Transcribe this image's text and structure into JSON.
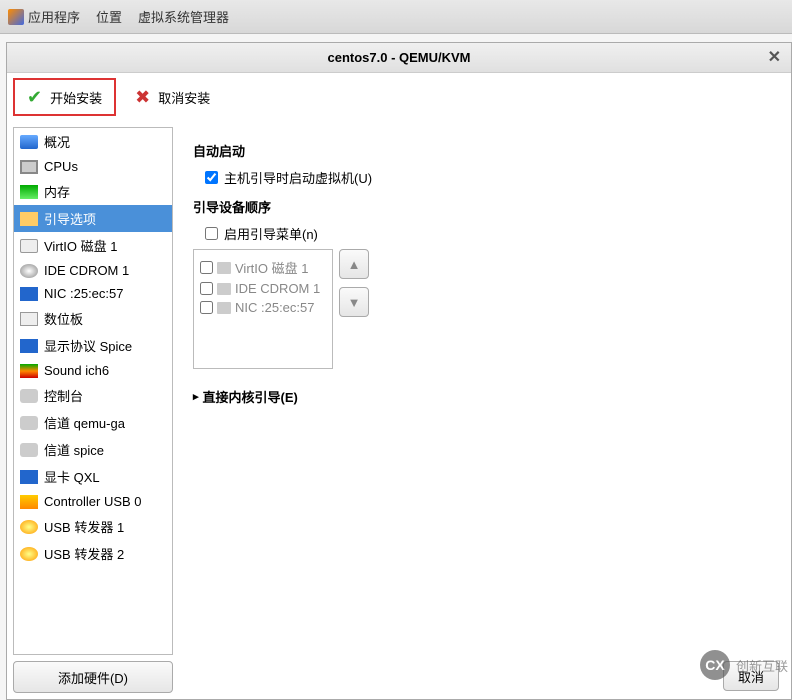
{
  "top_bar": {
    "apps": "应用程序",
    "places": "位置",
    "vmm": "虚拟系统管理器"
  },
  "window": {
    "title": "centos7.0 - QEMU/KVM"
  },
  "toolbar": {
    "begin_install": "开始安装",
    "cancel_install": "取消安装"
  },
  "sidebar": {
    "items": [
      {
        "label": "概况",
        "icon": "ic-monitor"
      },
      {
        "label": "CPUs",
        "icon": "ic-cpu"
      },
      {
        "label": "内存",
        "icon": "ic-mem"
      },
      {
        "label": "引导选项",
        "icon": "ic-boot",
        "selected": true
      },
      {
        "label": "VirtIO 磁盘 1",
        "icon": "ic-disk"
      },
      {
        "label": "IDE CDROM 1",
        "icon": "ic-cd"
      },
      {
        "label": "NIC :25:ec:57",
        "icon": "ic-nic"
      },
      {
        "label": "数位板",
        "icon": "ic-tablet"
      },
      {
        "label": "显示协议 Spice",
        "icon": "ic-display"
      },
      {
        "label": "Sound ich6",
        "icon": "ic-sound"
      },
      {
        "label": "控制台",
        "icon": "ic-serial"
      },
      {
        "label": "信道 qemu-ga",
        "icon": "ic-serial"
      },
      {
        "label": "信道 spice",
        "icon": "ic-serial"
      },
      {
        "label": "显卡 QXL",
        "icon": "ic-video"
      },
      {
        "label": "Controller USB 0",
        "icon": "ic-usb"
      },
      {
        "label": "USB 转发器 1",
        "icon": "ic-usbr"
      },
      {
        "label": "USB 转发器 2",
        "icon": "ic-usbr"
      }
    ],
    "add_hardware": "添加硬件(D)"
  },
  "main": {
    "autostart_title": "自动启动",
    "autostart_check": "主机引导时启动虚拟机(U)",
    "bootorder_title": "引导设备顺序",
    "enable_bootmenu": "启用引导菜单(n)",
    "boot_devices": [
      {
        "label": "VirtIO 磁盘 1"
      },
      {
        "label": "IDE CDROM 1"
      },
      {
        "label": "NIC :25:ec:57"
      }
    ],
    "direct_kernel": "直接内核引导(E)"
  },
  "bottom": {
    "cancel": "取消"
  },
  "watermark": "创新互联"
}
